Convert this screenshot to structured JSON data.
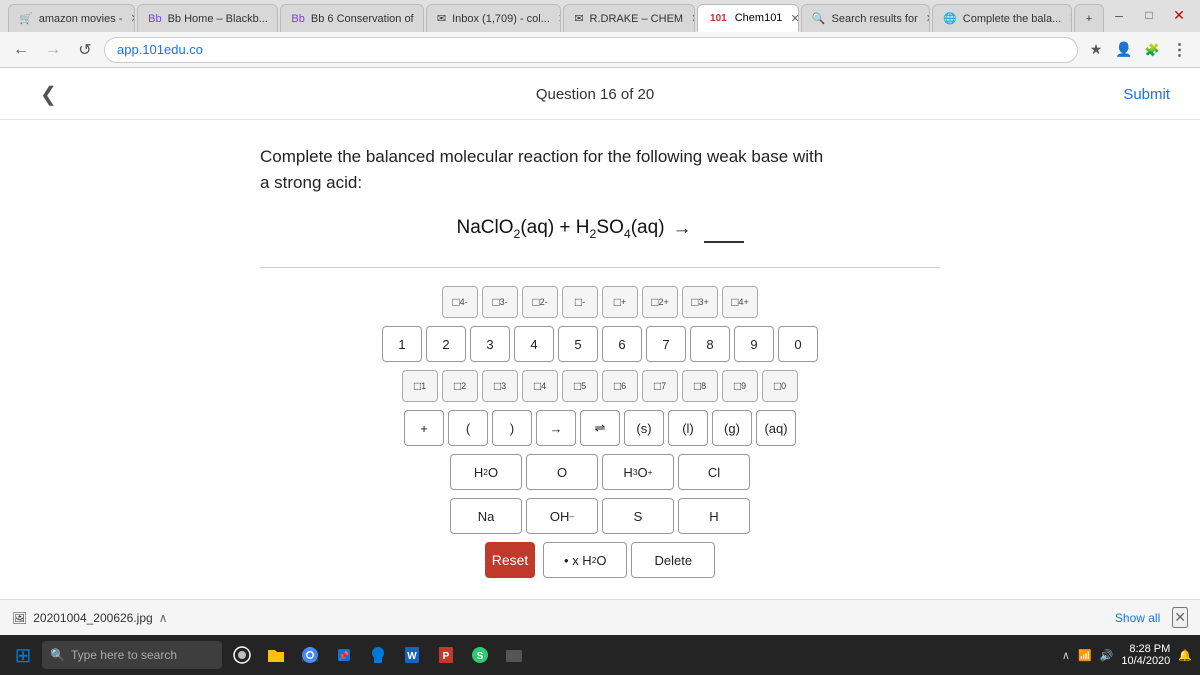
{
  "browser": {
    "tabs": [
      {
        "id": "amazon",
        "label": "amazon movies -",
        "active": false,
        "icon": "🛒"
      },
      {
        "id": "bb-home",
        "label": "Bb Home – Blackb...",
        "active": false,
        "icon": "📋"
      },
      {
        "id": "bb-conservation",
        "label": "Bb 6 Conservation of",
        "active": false,
        "icon": "📋"
      },
      {
        "id": "inbox",
        "label": "Inbox (1,709) - col...",
        "active": false,
        "icon": "✉"
      },
      {
        "id": "rdrake-chem",
        "label": "R.DRAKE – CHEM",
        "active": false,
        "icon": "✉"
      },
      {
        "id": "chem101",
        "label": "Chem101",
        "active": true,
        "icon": "101"
      },
      {
        "id": "search-results",
        "label": "Search results for",
        "active": false,
        "icon": "🔍"
      },
      {
        "id": "complete-bala",
        "label": "Complete the bala...",
        "active": false,
        "icon": "🌐"
      }
    ],
    "address": "app.101edu.co",
    "address_full": "app.101edu.co"
  },
  "page": {
    "back_arrow": "❮",
    "question_counter": "Question 16 of 20",
    "submit_label": "Submit",
    "question_text_line1": "Complete the balanced molecular reaction for the following weak base with",
    "question_text_line2": "a strong acid:",
    "reaction": {
      "left": "NaClO₂(aq) + H₂SO₄(aq)",
      "arrow": "→",
      "input_placeholder": ""
    }
  },
  "keyboard": {
    "charge_row": [
      {
        "label": "□⁴⁻",
        "sup": "4-"
      },
      {
        "label": "□³⁻",
        "sup": "3-"
      },
      {
        "label": "□²⁻",
        "sup": "2-"
      },
      {
        "label": "□⁻",
        "sup": "-"
      },
      {
        "label": "□⁺",
        "sup": "+"
      },
      {
        "label": "□²⁺",
        "sup": "2+"
      },
      {
        "label": "□³⁺",
        "sup": "3+"
      },
      {
        "label": "□⁴⁺",
        "sup": "4+"
      }
    ],
    "number_row": [
      "1",
      "2",
      "3",
      "4",
      "5",
      "6",
      "7",
      "8",
      "9",
      "0"
    ],
    "subscript_row": [
      {
        "label": "□₁",
        "sub": "1"
      },
      {
        "label": "□₂",
        "sub": "2"
      },
      {
        "label": "□₃",
        "sub": "3"
      },
      {
        "label": "□₄",
        "sub": "4"
      },
      {
        "label": "□₅",
        "sub": "5"
      },
      {
        "label": "□₆",
        "sub": "6"
      },
      {
        "label": "□₇",
        "sub": "7"
      },
      {
        "label": "□₈",
        "sub": "8"
      },
      {
        "label": "□₉",
        "sub": "9"
      },
      {
        "label": "□₀",
        "sub": "0"
      }
    ],
    "operator_row": [
      "+",
      "(",
      ")",
      "→",
      "⇌",
      "(s)",
      "(l)",
      "(g)",
      "(aq)"
    ],
    "compound_row1": [
      "H₂O",
      "O",
      "H₃O⁺",
      "Cl"
    ],
    "compound_row2": [
      "Na",
      "OH⁻",
      "S",
      "H"
    ],
    "action_row": {
      "reset": "Reset",
      "water": "• x H₂O",
      "delete": "Delete"
    }
  },
  "taskbar": {
    "search_placeholder": "Type here to search",
    "time": "8:28 PM",
    "date": "10/4/2020"
  },
  "download_bar": {
    "filename": "20201004_200626.jpg",
    "show_all": "Show all"
  },
  "colors": {
    "reset_btn": "#c0392b",
    "active_tab_bg": "#ffffff",
    "link_color": "#1a73e8"
  }
}
